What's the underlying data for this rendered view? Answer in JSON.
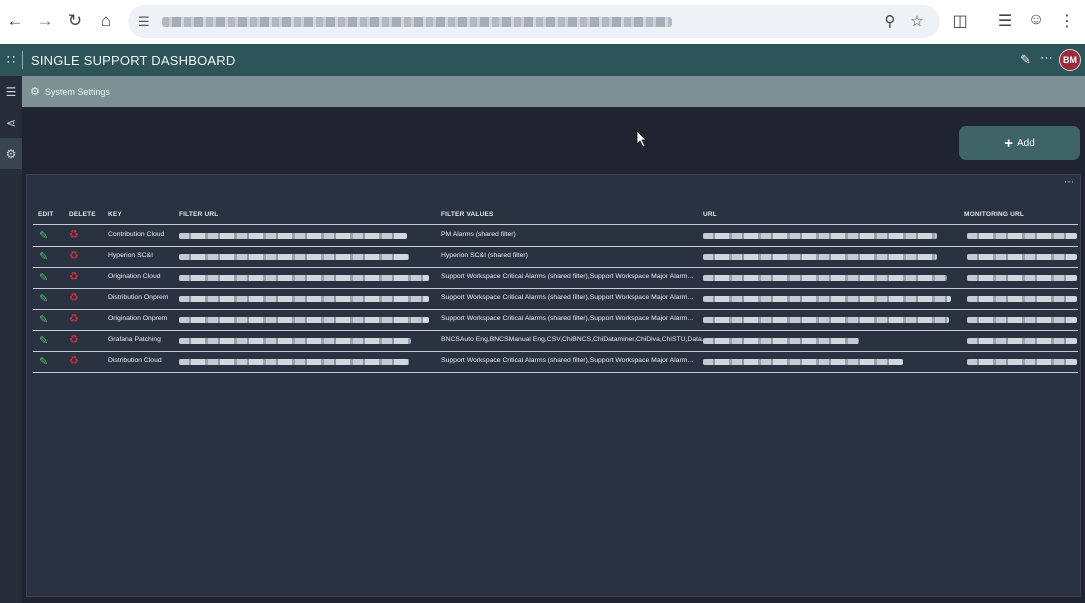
{
  "browser": {
    "back_icon": "arrow-left-icon",
    "forward_icon": "arrow-right-icon",
    "reload_icon": "reload-icon",
    "home_icon": "home-icon",
    "zoom_icon": "zoom-icon",
    "star_icon": "star-icon",
    "extensions_icon": "puzzle-icon",
    "media_icon": "media-icon",
    "profile_icon": "profile-icon",
    "menu_icon": "kebab-icon"
  },
  "app": {
    "title": "SINGLE SUPPORT DASHBOARD",
    "avatar_initials": "BM",
    "accent_color": "#2d5459",
    "avatar_color": "#9c2b3a"
  },
  "subheader": {
    "title": "System Settings"
  },
  "toolbar": {
    "add_label": "Add"
  },
  "table": {
    "headers": {
      "edit": "EDIT",
      "delete": "DELETE",
      "key": "KEY",
      "filter_url": "FILTER URL",
      "filter_values": "FILTER VALUES",
      "url": "URL",
      "monitoring_url": "MONITORING URL"
    },
    "rows": [
      {
        "key": "Contribution Cloud",
        "filter_values": "PM Alarms (shared filter)"
      },
      {
        "key": "Hyperion SC&I",
        "filter_values": "Hyperion SC&I (shared filter)"
      },
      {
        "key": "Origination Cloud",
        "filter_values": "Support Workspace Critical Alarms (shared filter),Support Workspace Major Alarm..."
      },
      {
        "key": "Distribution Onprem",
        "filter_values": "Support Workspace Critical Alarms (shared filter),Support Workspace Major Alarm..."
      },
      {
        "key": "Origination Onprem",
        "filter_values": "Support Workspace Critical Alarms (shared filter),Support Workspace Major Alarm..."
      },
      {
        "key": "Grafana Patching",
        "filter_values": "BNCSAuto Eng,BNCSManual Eng,CSV,ChiBNCS,ChiDataminer,ChiDiva,ChiSTU,Data..."
      },
      {
        "key": "Distribution Cloud",
        "filter_values": "Support Workspace Critical Alarms (shared filter),Support Workspace Major Alarm..."
      }
    ]
  }
}
